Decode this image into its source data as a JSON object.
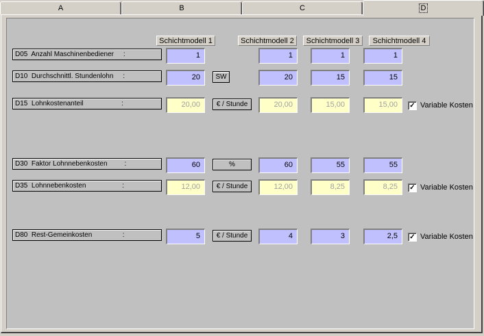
{
  "tabs": [
    "A",
    "B",
    "C",
    "D"
  ],
  "active_tab": "D",
  "columns": [
    "Schichtmodell 1",
    "Schichtmodell 2",
    "Schichtmodell 3",
    "Schichtmodell 4"
  ],
  "rows": [
    {
      "label": "D05  Anzahl Maschinenbediener     :",
      "unit": "",
      "values": [
        "1",
        "1",
        "1",
        "1"
      ],
      "editable": true,
      "checkbox": ""
    },
    {
      "label": "D10  Durchschnittl. Stundenlohn     :",
      "unit": "SW",
      "values": [
        "20",
        "20",
        "15",
        "15"
      ],
      "editable": true,
      "checkbox": ""
    },
    {
      "label": "D15  Lohnkostenanteil                    :",
      "unit": "€ / Stunde",
      "values": [
        "20,00",
        "20,00",
        "15,00",
        "15,00"
      ],
      "editable": false,
      "checkbox": "Variable Kosten"
    },
    {
      "label": "D30  Faktor Lohnnebenkosten         :",
      "unit": "%",
      "values": [
        "60",
        "60",
        "55",
        "55"
      ],
      "editable": true,
      "checkbox": ""
    },
    {
      "label": "D35  Lohnnebenkosten                   :",
      "unit": "€ / Stunde",
      "values": [
        "12,00",
        "12,00",
        "8,25",
        "8,25"
      ],
      "editable": false,
      "checkbox": "Variable Kosten"
    },
    {
      "label": "D80  Rest-Gemeinkosten                :",
      "unit": "€ / Stunde",
      "values": [
        "5",
        "4",
        "3",
        "2,5"
      ],
      "editable": true,
      "checkbox": "Variable Kosten"
    }
  ],
  "colors": {
    "input_bg": "#c0c0ff",
    "readonly_bg": "#ffffc8",
    "panel_bg": "#c0c0c0"
  }
}
